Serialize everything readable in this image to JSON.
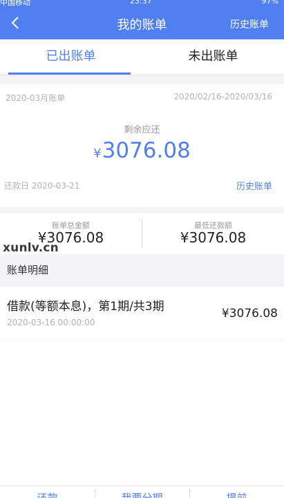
{
  "status_bar": {
    "carrier": "中国移动",
    "time": "23:37",
    "battery": "97%"
  },
  "nav": {
    "title": "我的账单",
    "right_label": "历史账单"
  },
  "tabs": [
    {
      "label": "已出账单"
    },
    {
      "label": "未出账单"
    }
  ],
  "bill": {
    "period": "2020-03月账单",
    "range": "2020/02/16-2020/03/16",
    "remaining_label": "剩余应还",
    "currency": "¥",
    "remaining_amount": "3076.08",
    "due_date": "还款日  2020-03-21",
    "history_link": "历史账单"
  },
  "totals": {
    "total_label": "账单总金额",
    "total_value": "¥3076.08",
    "minimum_label": "最低还款额",
    "minimum_value": "¥3076.08"
  },
  "watermark": "xunlv.cn",
  "details": {
    "section_title": "账单明细",
    "items": [
      {
        "title": "借款(等额本息)，第1期/共3期",
        "time": "2020-03-16 00:00:00",
        "amount": "¥3076.08"
      }
    ]
  },
  "bottom_bar": {
    "buttons": [
      {
        "label": "还款"
      },
      {
        "label": "我要分期"
      },
      {
        "label": "提前"
      }
    ]
  },
  "colors": {
    "accent": "#4f7ff0"
  }
}
